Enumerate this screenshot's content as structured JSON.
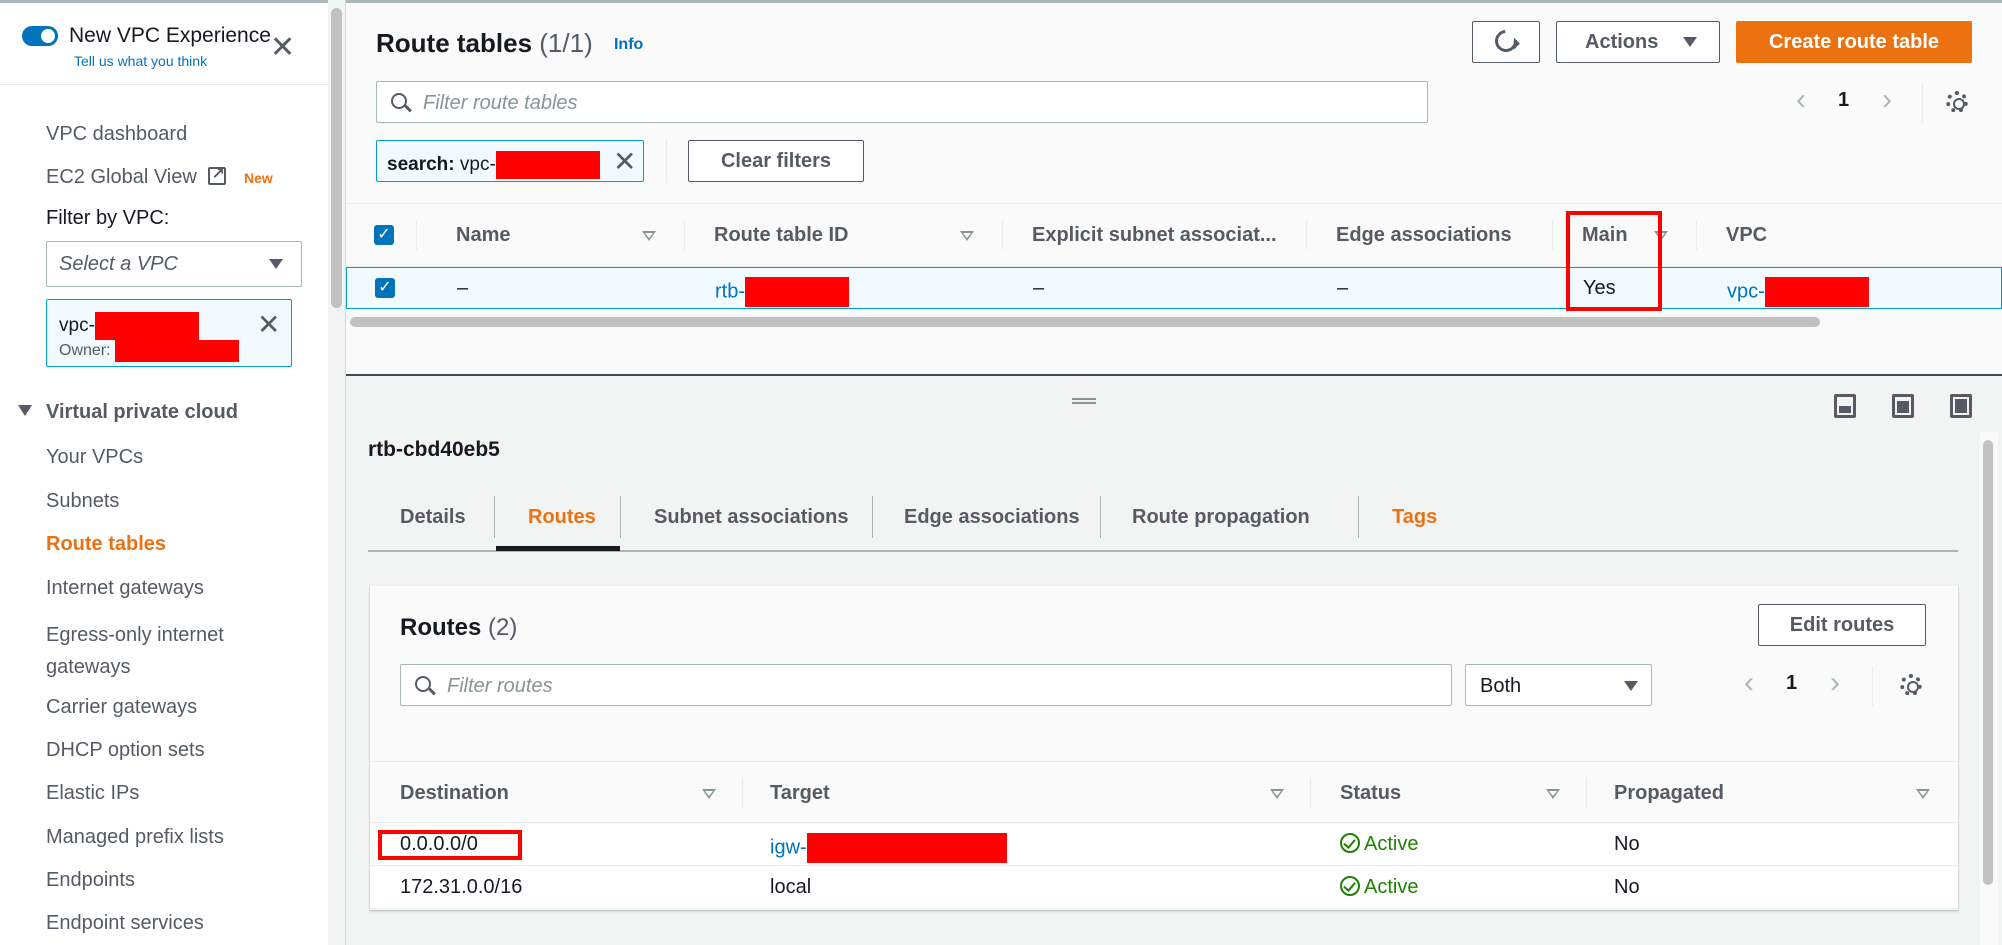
{
  "sidebar": {
    "experience_toggle_label": "New VPC Experience",
    "feedback_link": "Tell us what you think",
    "close_label": "✕",
    "top_items": [
      {
        "label": "VPC dashboard"
      },
      {
        "label": "EC2 Global View",
        "badge": "New"
      }
    ],
    "filter_label": "Filter by VPC:",
    "vpc_select_placeholder": "Select a VPC",
    "vpc_token": {
      "prefix": "vpc-",
      "owner_label": "Owner:",
      "remove_label": "✕"
    },
    "section_title": "Virtual private cloud",
    "items": [
      {
        "label": "Your VPCs"
      },
      {
        "label": "Subnets"
      },
      {
        "label": "Route tables",
        "active": true
      },
      {
        "label": "Internet gateways"
      },
      {
        "label": "Egress-only internet gateways"
      },
      {
        "label": "Carrier gateways"
      },
      {
        "label": "DHCP option sets"
      },
      {
        "label": "Elastic IPs"
      },
      {
        "label": "Managed prefix lists"
      },
      {
        "label": "Endpoints"
      },
      {
        "label": "Endpoint services"
      }
    ]
  },
  "route_tables": {
    "title": "Route tables",
    "count": "(1/1)",
    "info_link": "Info",
    "actions_label": "Actions",
    "create_label": "Create route table",
    "filter_placeholder": "Filter route tables",
    "search_token_key": "search:",
    "search_token_value": "vpc-",
    "clear_filters_label": "Clear filters",
    "page_number": "1",
    "columns": [
      "Name",
      "Route table ID",
      "Explicit subnet associat...",
      "Edge associations",
      "Main",
      "VPC"
    ],
    "rows": [
      {
        "name": "–",
        "route_table_id": "rtb-",
        "explicit_subnet": "–",
        "edge_associations": "–",
        "main": "Yes",
        "vpc": "vpc-",
        "selected": true
      }
    ]
  },
  "details": {
    "title": "rtb-cbd40eb5",
    "tabs": [
      {
        "label": "Details"
      },
      {
        "label": "Routes",
        "active": true
      },
      {
        "label": "Subnet associations"
      },
      {
        "label": "Edge associations"
      },
      {
        "label": "Route propagation"
      },
      {
        "label": "Tags"
      }
    ],
    "routes": {
      "title": "Routes",
      "count": "(2)",
      "edit_label": "Edit routes",
      "filter_placeholder": "Filter routes",
      "type_filter_value": "Both",
      "page_number": "1",
      "columns": [
        "Destination",
        "Target",
        "Status",
        "Propagated"
      ],
      "rows": [
        {
          "destination": "0.0.0.0/0",
          "target": "igw-",
          "target_is_link": true,
          "status": "Active",
          "propagated": "No"
        },
        {
          "destination": "172.31.0.0/16",
          "target": "local",
          "target_is_link": false,
          "status": "Active",
          "propagated": "No"
        }
      ]
    }
  },
  "colors": {
    "accent_orange": "#ec7211",
    "link_blue": "#0073bb",
    "success_green": "#1d8102",
    "redaction_red": "#ff0000"
  }
}
